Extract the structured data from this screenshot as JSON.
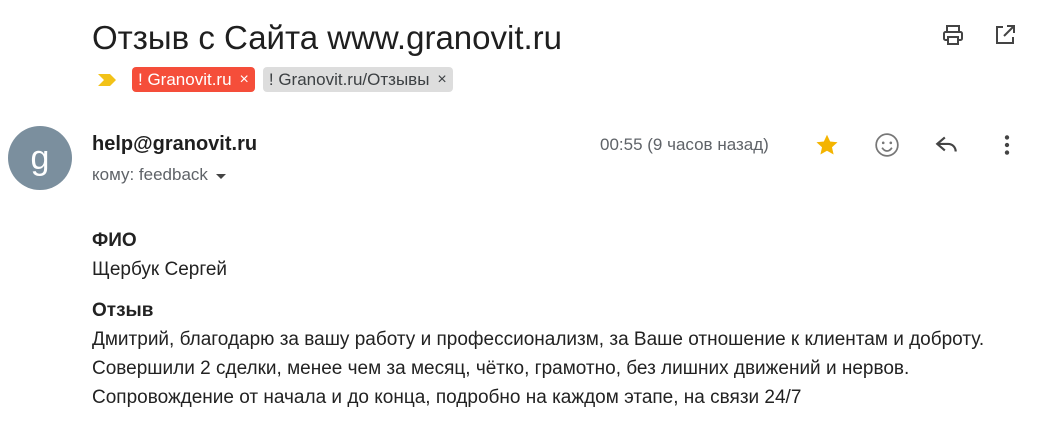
{
  "email": {
    "subject": "Отзыв с Сайта www.granovit.ru",
    "labels": [
      {
        "text": "! Granovit.ru",
        "color": "#f54e3a"
      },
      {
        "text": "! Granovit.ru/Отзывы",
        "color": "#dddddd"
      }
    ],
    "label_remove_symbol": "×",
    "sender": {
      "avatar_letter": "g",
      "address": "help@granovit.ru",
      "recipient_line": "кому: feedback"
    },
    "timestamp": "00:55 (9 часов назад)",
    "starred": true,
    "icons": {
      "print": "print-icon",
      "open_new_window": "open-in-new-icon",
      "importance": "importance-marker-icon",
      "star": "star-icon",
      "emoji": "emoji-icon",
      "reply": "reply-icon",
      "more": "more-vert-icon"
    },
    "body": {
      "name_label": "ФИО",
      "name_value": "Щербук Сергей",
      "review_label": "Отзыв",
      "review_lines": [
        "Дмитрий, благодарю за вашу работу и профессионализм, за Ваше отношение к клиентам и доброту.",
        "Совершили 2 сделки, менее чем за месяц, чётко, грамотно, без лишних движений и нервов.",
        "Сопровождение от начала и до конца, подробно на каждом этапе, на связи 24/7"
      ]
    }
  },
  "colors": {
    "accent_star": "#f4b400",
    "importance": "#f2c218",
    "avatar_bg": "#7b8f9e"
  }
}
